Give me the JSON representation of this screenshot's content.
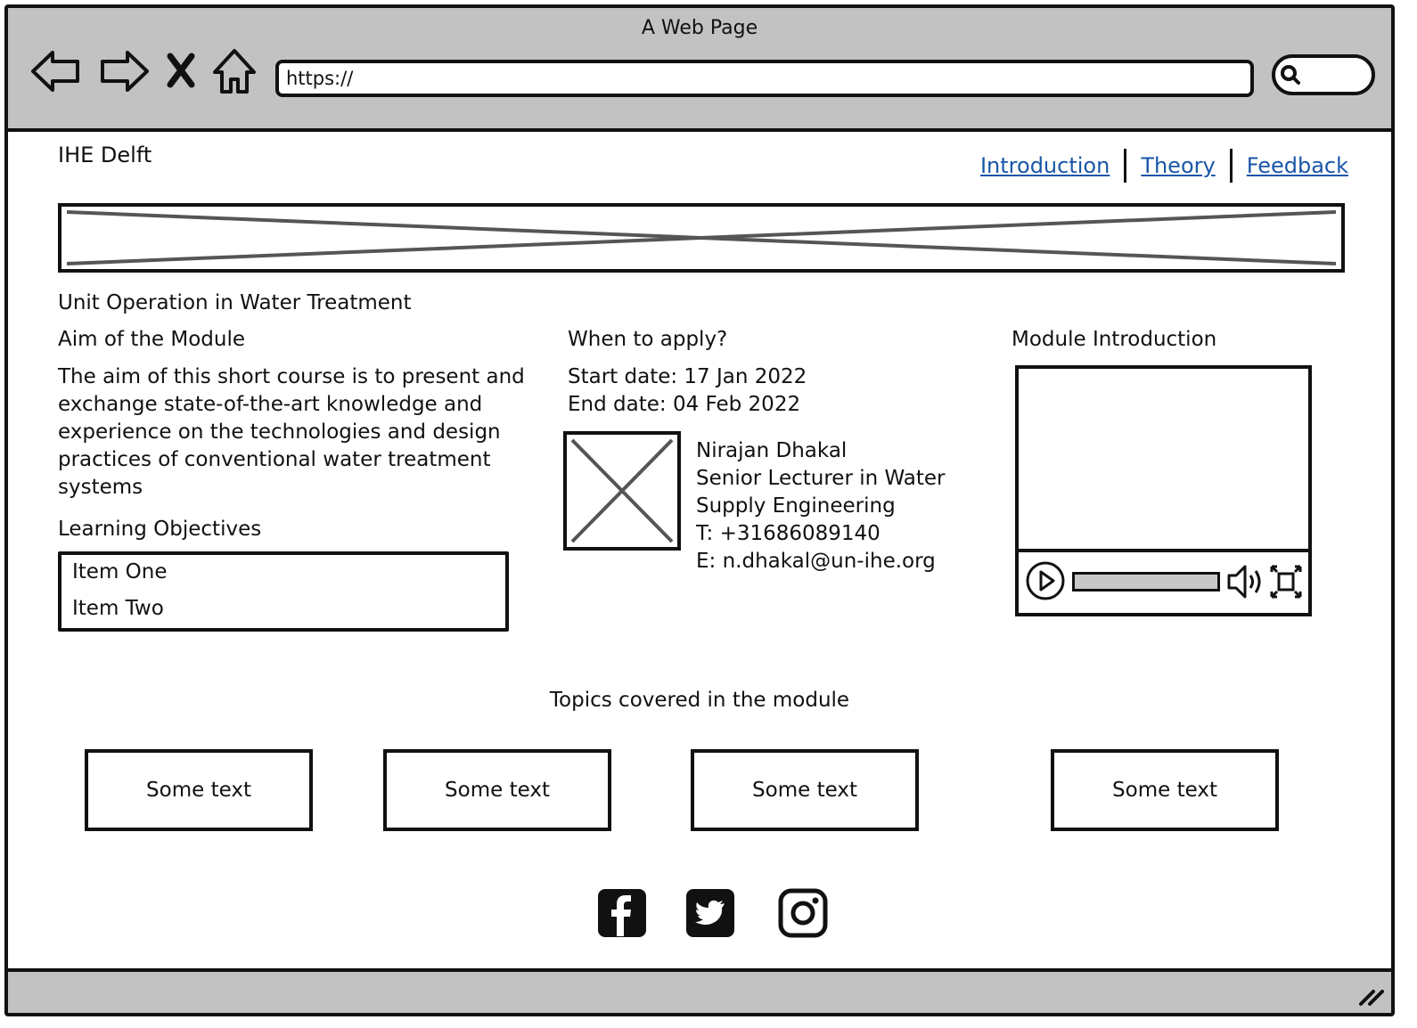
{
  "window": {
    "title": "A Web Page"
  },
  "browser": {
    "url": "https://",
    "nav_icons": [
      "back-arrow-icon",
      "forward-arrow-icon",
      "close-icon",
      "home-icon"
    ],
    "search_icon": "search-icon"
  },
  "header": {
    "brand": "IHE Delft",
    "nav": [
      {
        "label": "Introduction"
      },
      {
        "label": "Theory"
      },
      {
        "label": "Feedback"
      }
    ]
  },
  "page": {
    "title": "Unit Operation in Water Treatment",
    "aim_heading": "Aim of the Module",
    "aim_text": "The aim of this short course is to present and exchange state-of-the-art knowledge and experience on the technologies and design practices of conventional water treatment systems",
    "objectives_heading": "Learning Objectives",
    "objectives": [
      "Item One",
      "Item Two"
    ],
    "apply_heading": "When to apply?",
    "start_date": "Start date: 17 Jan 2022",
    "end_date": "End date: 04 Feb 2022",
    "contact": {
      "name": "Nirajan Dhakal",
      "role": "Senior Lecturer in Water Supply Engineering",
      "phone": "T: +31686089140",
      "email": "E: n.dhakal@un-ihe.org"
    },
    "video_heading": "Module Introduction",
    "video_progress": 0.0,
    "topics_heading": "Topics covered in the module",
    "topics": [
      "Some text",
      "Some text",
      "Some text",
      "Some text"
    ]
  },
  "social": [
    "facebook-icon",
    "twitter-icon",
    "instagram-icon"
  ],
  "colors": {
    "chrome": "#c2c2c2",
    "link": "#1a56a8",
    "stroke": "#111111"
  }
}
